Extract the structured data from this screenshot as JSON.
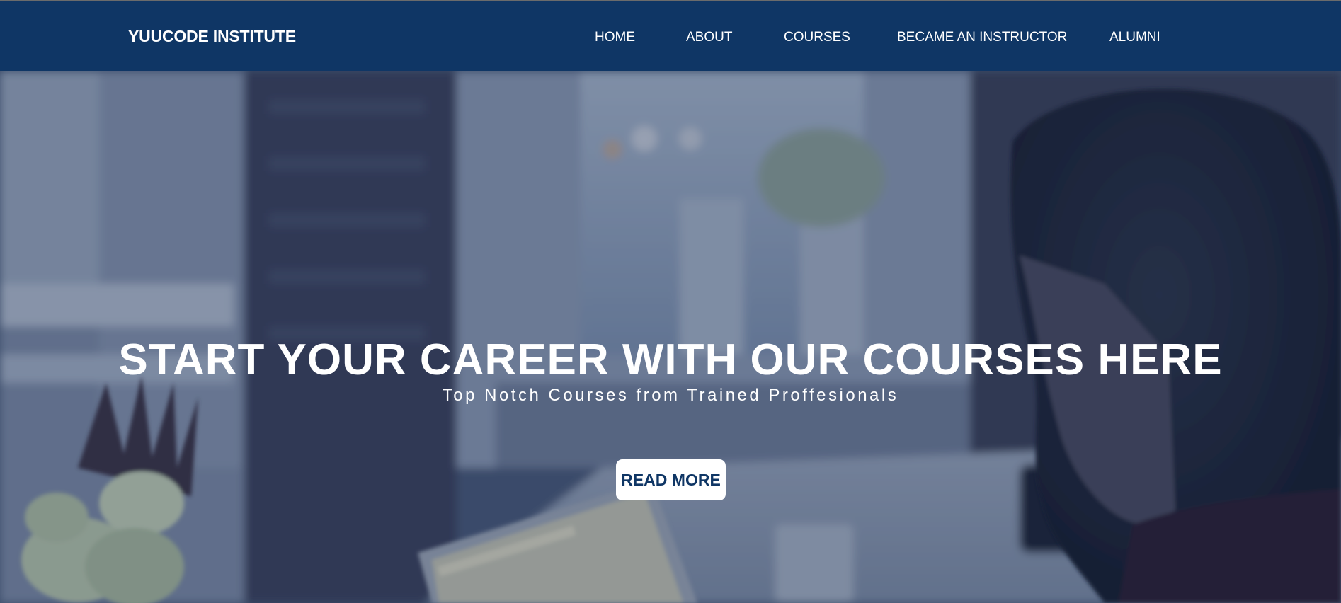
{
  "brand": {
    "name": "YUUCODE INSTITUTE"
  },
  "nav": {
    "items": [
      {
        "label": "HOME"
      },
      {
        "label": "ABOUT"
      },
      {
        "label": "COURSES"
      },
      {
        "label": "BECAME AN INSTRUCTOR"
      },
      {
        "label": "ALUMNI"
      }
    ]
  },
  "hero": {
    "headline": "START YOUR CAREER WITH OUR COURSES HERE",
    "subheadline": "Top Notch Courses from Trained Proffesionals",
    "cta_label": "READ MORE",
    "background_image": "office-workspace-photo"
  },
  "colors": {
    "nav_background": "#0f3665",
    "text": "#ffffff",
    "button_background": "#ffffff",
    "button_text": "#0f3665"
  }
}
